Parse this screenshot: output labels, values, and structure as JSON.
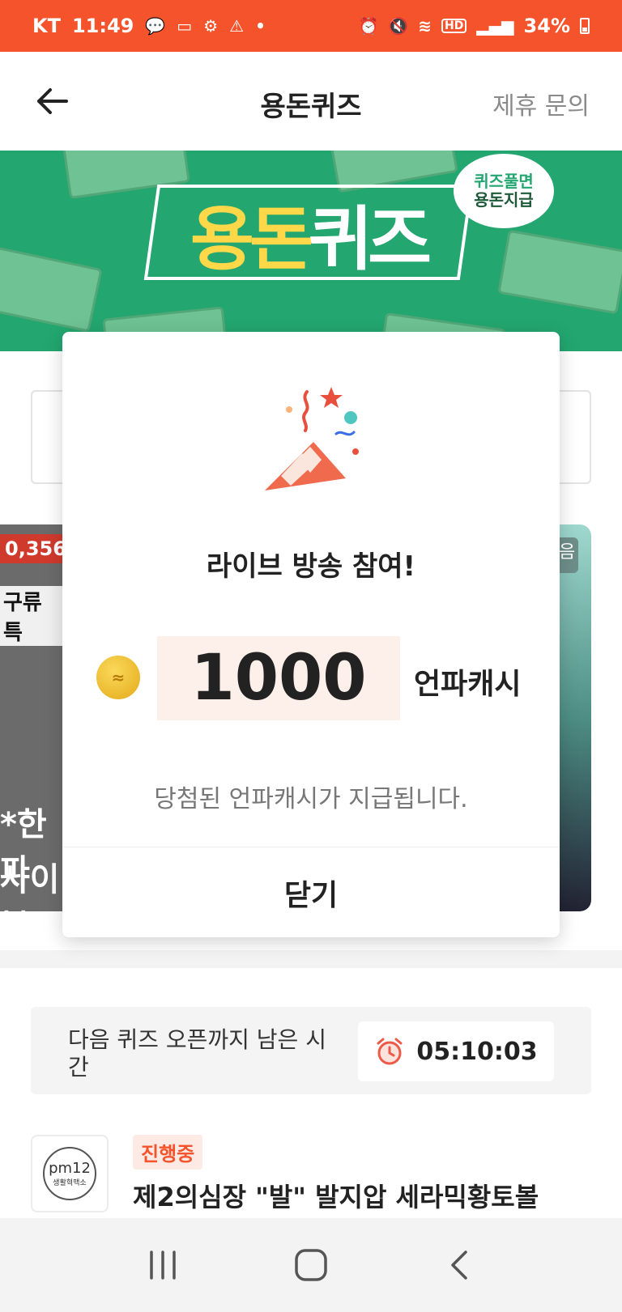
{
  "status_bar": {
    "carrier": "KT",
    "time": "11:49",
    "battery": "34%",
    "left_icons": [
      "talk-icon",
      "message-icon",
      "bike-icon",
      "warning-icon",
      "dot-icon"
    ],
    "right_icons": [
      "alarm-icon",
      "mute-icon",
      "wifi-icon",
      "hd-icon",
      "signal-icon",
      "battery-icon"
    ]
  },
  "header": {
    "title": "용돈퀴즈",
    "action": "제휴 문의"
  },
  "banner": {
    "logo_part1": "용돈",
    "logo_part2": "퀴즈",
    "bubble_line1": "퀴즈풀면",
    "bubble_line2": "용돈지급",
    "bill_text": "용돈퀴즈"
  },
  "background_cards": {
    "left_count": "0,356",
    "left_text1": "구류 특",
    "left_text2": "*한파",
    "left_text3": "사이블",
    "right_tag": "음"
  },
  "timer": {
    "label": "다음 퀴즈 오픈까지 남은 시간",
    "value": "05:10:03"
  },
  "quiz_item": {
    "thumb_brand": "pm12",
    "thumb_sub": "생활혁맥소",
    "status": "진행중",
    "title": "제2의심장 \"발\" 발지압 세라믹황토볼"
  },
  "modal": {
    "title": "라이브 방송 참여!",
    "amount": "1000",
    "unit": "언파캐시",
    "description": "당첨된 언파캐시가 지급됩니다.",
    "close_label": "닫기"
  },
  "colors": {
    "status_bar": "#f5532b",
    "banner": "#23a66f",
    "accent": "#f5532b",
    "amount_bg": "#fdf0ea"
  }
}
